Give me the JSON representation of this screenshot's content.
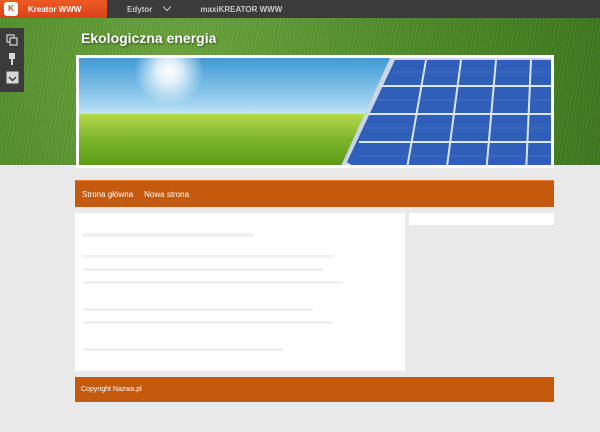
{
  "editor": {
    "brand_logo": "K",
    "brand_label": "Kreator WWW",
    "menu": [
      {
        "label": "Edytor"
      },
      {
        "label": "maxiKREATOR WWW"
      }
    ],
    "tools": [
      "copy-pages-icon",
      "paint-brush-icon",
      "image-icon"
    ]
  },
  "site": {
    "title": "Ekologiczna energia",
    "nav": [
      {
        "label": "Strona główna"
      },
      {
        "label": "Nowa strona"
      }
    ],
    "footer": "Copyright Nazwa.pl"
  },
  "colors": {
    "accent": "#c55a0e",
    "topbar": "#3b3b3b",
    "brand": "#e34d1f"
  }
}
